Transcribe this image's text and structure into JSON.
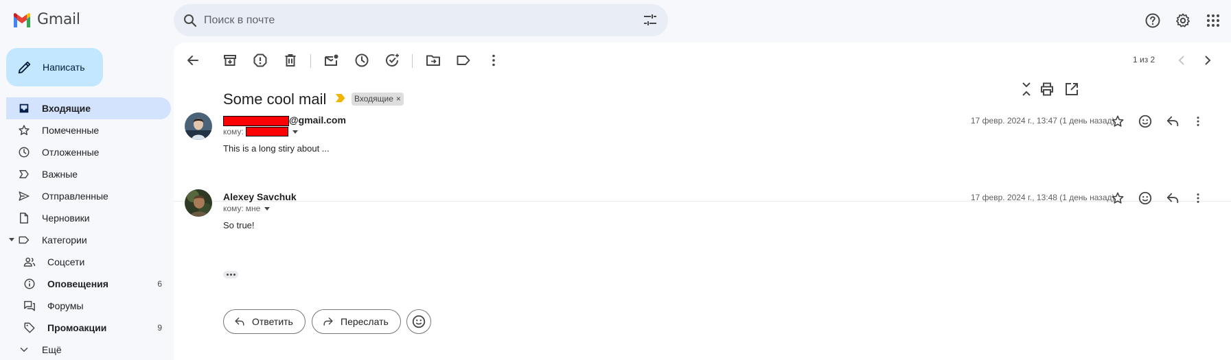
{
  "app": {
    "name": "Gmail"
  },
  "search": {
    "placeholder": "Поиск в почте"
  },
  "compose": {
    "label": "Написать"
  },
  "sidebar": {
    "items": [
      {
        "label": "Входящие",
        "icon": "inbox-icon"
      },
      {
        "label": "Помеченные",
        "icon": "star-icon"
      },
      {
        "label": "Отложенные",
        "icon": "clock-icon"
      },
      {
        "label": "Важные",
        "icon": "important-icon"
      },
      {
        "label": "Отправленные",
        "icon": "send-icon"
      },
      {
        "label": "Черновики",
        "icon": "draft-icon"
      },
      {
        "label": "Категории",
        "icon": "label-icon"
      },
      {
        "label": "Соцсети",
        "icon": "people-icon"
      },
      {
        "label": "Оповещения",
        "icon": "info-icon",
        "count": "6"
      },
      {
        "label": "Форумы",
        "icon": "forum-icon"
      },
      {
        "label": "Промоакции",
        "icon": "tag-icon",
        "count": "9"
      },
      {
        "label": "Ещё",
        "icon": "chevron-down-icon"
      }
    ]
  },
  "pager": {
    "text": "1 из 2"
  },
  "thread": {
    "subject": "Some cool mail",
    "label_chip": "Входящие",
    "label_chip_close": "×",
    "messages": [
      {
        "sender_suffix": "@gmail.com",
        "to_prefix": "кому:",
        "to_value": "",
        "date": "17 февр. 2024 г., 13:47 (1 день назад)",
        "body": "This is a long stiry about ..."
      },
      {
        "sender": "Alexey Savchuk",
        "to_prefix": "кому:",
        "to_value": "мне",
        "date": "17 февр. 2024 г., 13:48 (1 день назад)",
        "body": "So true!"
      }
    ]
  },
  "actions": {
    "reply": "Ответить",
    "forward": "Переслать"
  },
  "colors": {
    "background": "#f6f8fc",
    "compose_bg": "#c2e7ff",
    "active_nav": "#d3e3fd",
    "importance_marker": "#f2b400",
    "redaction": "#ff0000"
  }
}
